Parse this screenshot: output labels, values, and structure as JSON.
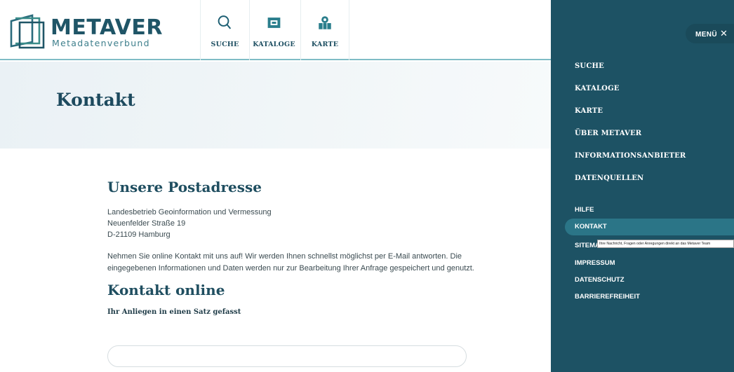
{
  "logo": {
    "title": "METAVER",
    "subtitle": "Metadatenverbund"
  },
  "nav": [
    {
      "label": "SUCHE",
      "icon": "search-icon"
    },
    {
      "label": "KATALOGE",
      "icon": "catalog-icon"
    },
    {
      "label": "KARTE",
      "icon": "map-icon"
    }
  ],
  "page": {
    "title": "Kontakt"
  },
  "address": {
    "heading": "Unsere Postadresse",
    "lines": [
      "Landesbetrieb Geoinformation und Vermessung",
      "Neuenfelder Straße 19",
      "D-21109 Hamburg"
    ]
  },
  "intro": "Nehmen Sie online Kontakt mit uns auf! Wir werden Ihnen schnellst möglichst per E-Mail antworten. Die eingegebenen Informationen und Daten werden nur zur Bearbeitung Ihrer Anfrage gespeichert und genutzt.",
  "contact": {
    "heading": "Kontakt online",
    "field_label": "Ihr Anliegen in einen Satz gefasst",
    "field_value": ""
  },
  "menu": {
    "toggle_label": "MENÜ",
    "toggle_icon": "close-icon",
    "main_items": [
      "SUCHE",
      "KATALOGE",
      "KARTE",
      "ÜBER METAVER",
      "INFORMATIONSANBIETER",
      "DATENQUELLEN"
    ],
    "secondary_items": [
      "HILFE",
      "KONTAKT",
      "SITEMAP",
      "IMPRESSUM",
      "DATENSCHUTZ",
      "BARRIEREFREIHEIT"
    ],
    "active_item": "KONTAKT",
    "tooltip": "Ihre Nachricht, Fragen oder Anregungen direkt an das Metaver Team"
  },
  "colors": {
    "accent": "#1d5264",
    "active": "#2b7587",
    "title_band": "#eaf1f5"
  }
}
